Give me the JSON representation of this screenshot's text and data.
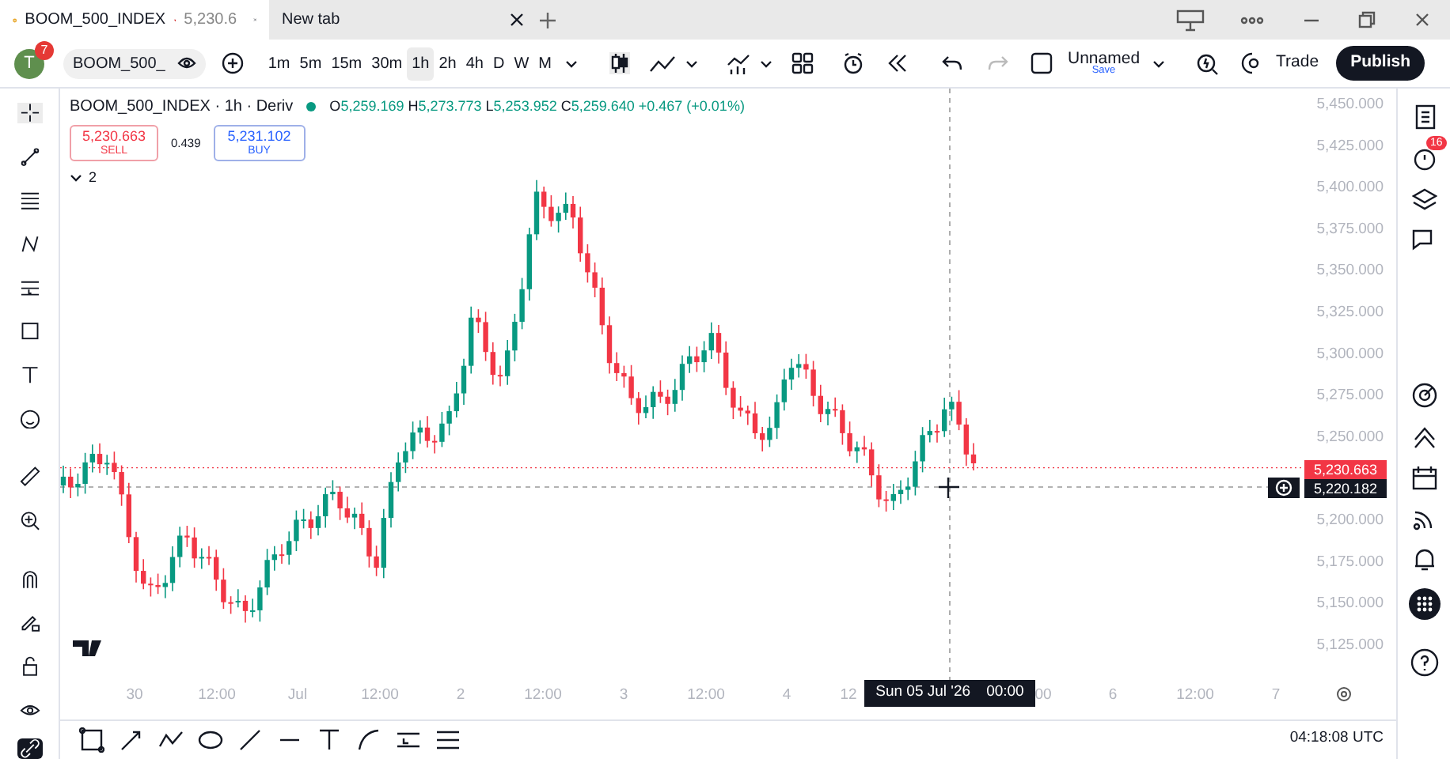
{
  "browser_tabs": [
    {
      "title": "BOOM_500_INDEX",
      "price": "5,230.6",
      "selected": true
    },
    {
      "title": "New tab",
      "selected": false
    }
  ],
  "toolbar": {
    "avatar": "T",
    "avatar_badge": "7",
    "symbol": "BOOM_500_",
    "intervals": [
      {
        "label": "1m",
        "selected": false
      },
      {
        "label": "5m",
        "selected": false
      },
      {
        "label": "15m",
        "selected": false
      },
      {
        "label": "30m",
        "selected": false
      },
      {
        "label": "1h",
        "selected": true
      },
      {
        "label": "2h",
        "selected": false
      },
      {
        "label": "4h",
        "selected": false
      },
      {
        "label": "D",
        "selected": false
      },
      {
        "label": "W",
        "selected": false
      },
      {
        "label": "M",
        "selected": false
      }
    ],
    "layout_name": "Unnamed",
    "save": "Save",
    "trade": "Trade",
    "publish": "Publish"
  },
  "legend": {
    "title": "BOOM_500_INDEX · 1h · Deriv",
    "ohlc": [
      {
        "label": "O",
        "value": "5,259.169"
      },
      {
        "label": "H",
        "value": "5,273.773"
      },
      {
        "label": "L",
        "value": "5,253.952"
      },
      {
        "label": "C",
        "value": "5,259.640"
      }
    ],
    "change": "+0.467 (+0.01%)",
    "sell_price": "5,230.663",
    "sell": "SELL",
    "spread": "0.439",
    "buy_price": "5,231.102",
    "buy": "BUY",
    "indicators": "2"
  },
  "price_axis": [
    "5,450.000",
    "5,425.000",
    "5,400.000",
    "5,375.000",
    "5,350.000",
    "5,325.000",
    "5,300.000",
    "5,275.000",
    "5,250.000",
    "5,200.000",
    "5,175.000",
    "5,150.000",
    "5,125.000"
  ],
  "last_price": "5,230.663",
  "crosshair_price": "5,220.182",
  "time_axis": [
    "30",
    "12:00",
    "Jul",
    "12:00",
    "2",
    "12:00",
    "3",
    "12:00",
    "4",
    "12",
    "00",
    "6",
    "12:00",
    "7"
  ],
  "crosshair_time": {
    "date": "Sun 05 Jul '26",
    "time": "00:00"
  },
  "clock": "04:18:08 UTC",
  "sidebar_badge": "16"
}
